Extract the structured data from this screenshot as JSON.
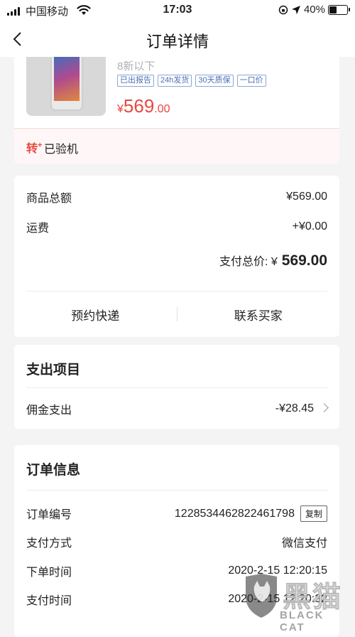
{
  "status_bar": {
    "carrier": "中国移动",
    "time": "17:03",
    "battery": "40%"
  },
  "nav": {
    "title": "订单详情"
  },
  "product": {
    "subtitle": "8新以下",
    "tags": [
      "已出报告",
      "24h发货",
      "30天质保",
      "一口价"
    ],
    "price_currency": "¥",
    "price_int": "569",
    "price_dec": ".00",
    "brand_mark": "转",
    "brand_sup": "+",
    "inspected_label": "已验机"
  },
  "summary": {
    "goods_total_label": "商品总额",
    "goods_total_value": "¥569.00",
    "shipping_label": "运费",
    "shipping_value": "+¥0.00",
    "total_label": "支付总价: ¥",
    "total_value": "569.00",
    "action_book": "预约快递",
    "action_contact": "联系买家"
  },
  "expense": {
    "title": "支出项目",
    "commission_label": "佣金支出",
    "commission_value": "-¥28.45"
  },
  "order_info": {
    "title": "订单信息",
    "rows": [
      {
        "label": "订单编号",
        "value": "1228534462822461798"
      },
      {
        "label": "支付方式",
        "value": "微信支付"
      },
      {
        "label": "下单时间",
        "value": "2020-2-15 12:20:15"
      },
      {
        "label": "支付时间",
        "value": "2020-2-15 12:20:32"
      }
    ],
    "copy_label": "复制"
  },
  "watermark": {
    "cn": "黑猫",
    "en": "BLACK CAT"
  }
}
